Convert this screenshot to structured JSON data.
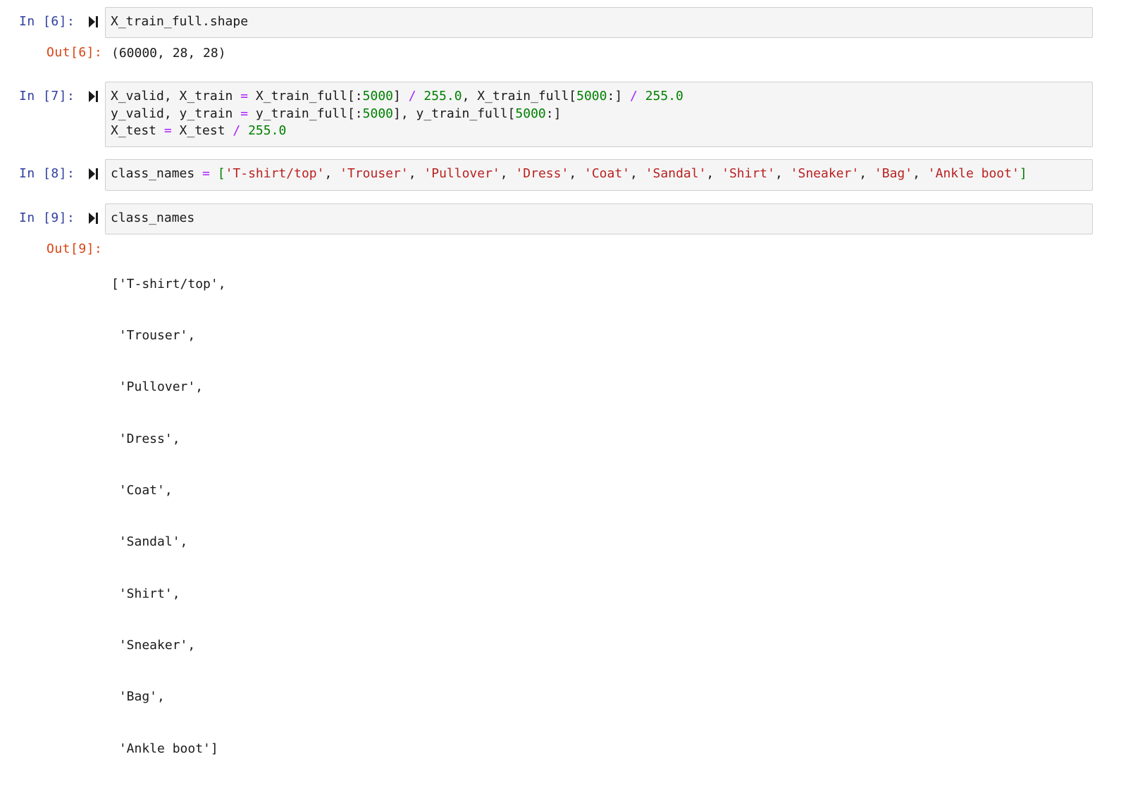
{
  "cells": [
    {
      "in_prompt": "In [6]:",
      "code_lines": [
        "X_train_full.shape"
      ],
      "out_prompt": "Out[6]:",
      "output_lines": [
        "(60000, 28, 28)"
      ]
    },
    {
      "in_prompt": "In [7]:",
      "code_lines": [
        {
          "t1": "X_valid, X_train ",
          "eq": "=",
          "t2": " X_train_full[:",
          "n1": "5000",
          "t3": "] ",
          "op": "/",
          "sp": " ",
          "n2": "255.0",
          "t4": ", X_train_full[",
          "n3": "5000",
          "t5": ":] ",
          "op2": "/",
          "sp2": " ",
          "n4": "255.0"
        },
        {
          "t1": "y_valid, y_train ",
          "eq": "=",
          "t2": " y_train_full[:",
          "n1": "5000",
          "t3": "], y_train_full[",
          "n2": "5000",
          "t4": ":]"
        },
        {
          "t1": "X_test ",
          "eq": "=",
          "t2": " X_test ",
          "op": "/",
          "sp": " ",
          "n1": "255.0"
        }
      ]
    },
    {
      "in_prompt": "In [8]:",
      "code_lines": [
        {
          "var": "class_names ",
          "eq": "=",
          "open": " [",
          "items": [
            "'T-shirt/top'",
            "'Trouser'",
            "'Pullover'",
            "'Dress'",
            "'Coat'",
            "'Sandal'",
            "'Shirt'",
            "'Sneaker'",
            "'Bag'",
            "'Ankle boot'"
          ],
          "close": "]"
        }
      ]
    },
    {
      "in_prompt": "In [9]:",
      "code_lines": [
        "class_names"
      ],
      "out_prompt": "Out[9]:",
      "output_lines": [
        "['T-shirt/top',",
        " 'Trouser',",
        " 'Pullover',",
        " 'Dress',",
        " 'Coat',",
        " 'Sandal',",
        " 'Shirt',",
        " 'Sneaker',",
        " 'Bag',",
        " 'Ankle boot']"
      ]
    }
  ],
  "icons": {
    "run": "run-cell-icon"
  },
  "colors": {
    "in_prompt": "#303f9f",
    "out_prompt": "#d84315",
    "string": "#ba2121",
    "number": "#008000",
    "operator": "#aa22ff"
  }
}
